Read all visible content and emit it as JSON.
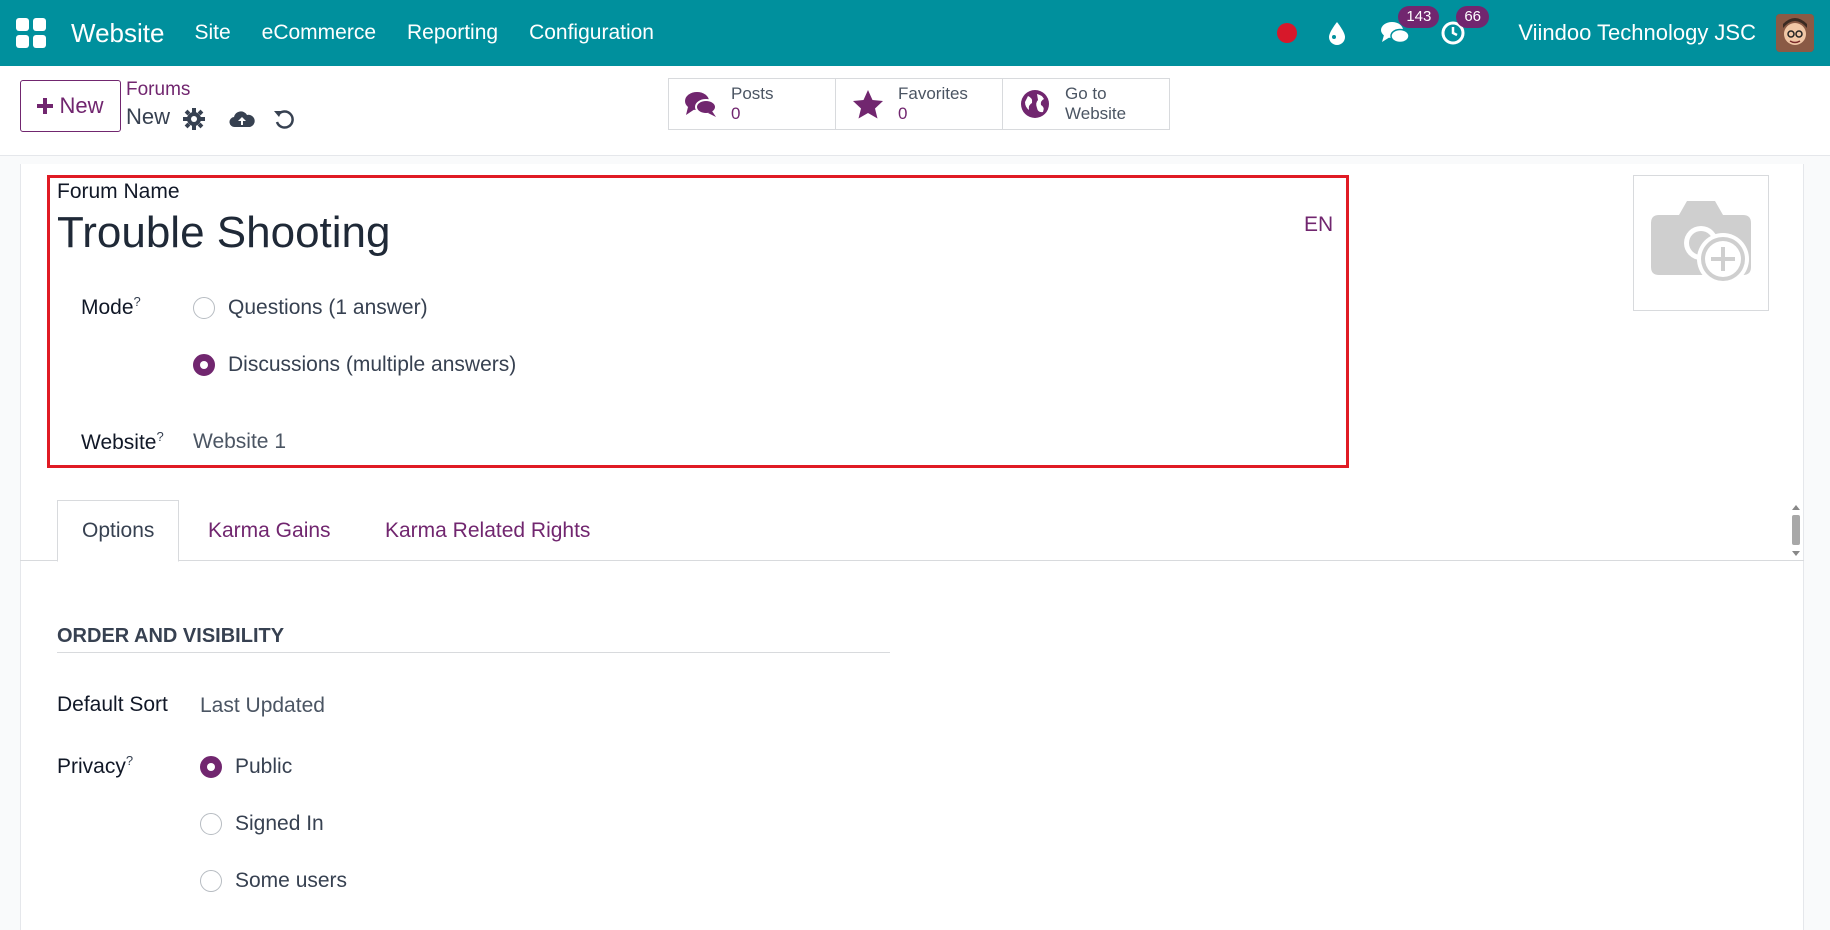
{
  "navbar": {
    "app_name": "Website",
    "menu": [
      "Site",
      "eCommerce",
      "Reporting",
      "Configuration"
    ],
    "messages_count": "143",
    "activities_count": "66",
    "company": "Viindoo Technology JSC",
    "bg_color": "#00909d",
    "badge_color": "#71266f"
  },
  "control_panel": {
    "new_label": "New",
    "breadcrumb_parent": "Forums",
    "breadcrumb_current": "New"
  },
  "smart_buttons": {
    "posts": {
      "label": "Posts",
      "value": "0"
    },
    "favorites": {
      "label": "Favorites",
      "value": "0"
    },
    "website": {
      "line1": "Go to",
      "line2": "Website"
    }
  },
  "form": {
    "forum_name_label": "Forum Name",
    "forum_name": "Trouble Shooting",
    "lang": "EN",
    "mode_label": "Mode",
    "mode_options": [
      "Questions (1 answer)",
      "Discussions (multiple answers)"
    ],
    "mode_selected": "Discussions (multiple answers)",
    "website_label": "Website",
    "website_value": "Website 1",
    "help_mark": "?"
  },
  "tabs": [
    "Options",
    "Karma Gains",
    "Karma Related Rights"
  ],
  "options": {
    "section_title": "ORDER AND VISIBILITY",
    "default_sort_label": "Default Sort",
    "default_sort_value": "Last Updated",
    "privacy_label": "Privacy",
    "privacy_options": [
      "Public",
      "Signed In",
      "Some users"
    ],
    "privacy_selected": "Public"
  },
  "colors": {
    "accent": "#71266f",
    "highlight_border": "#e01b24"
  }
}
